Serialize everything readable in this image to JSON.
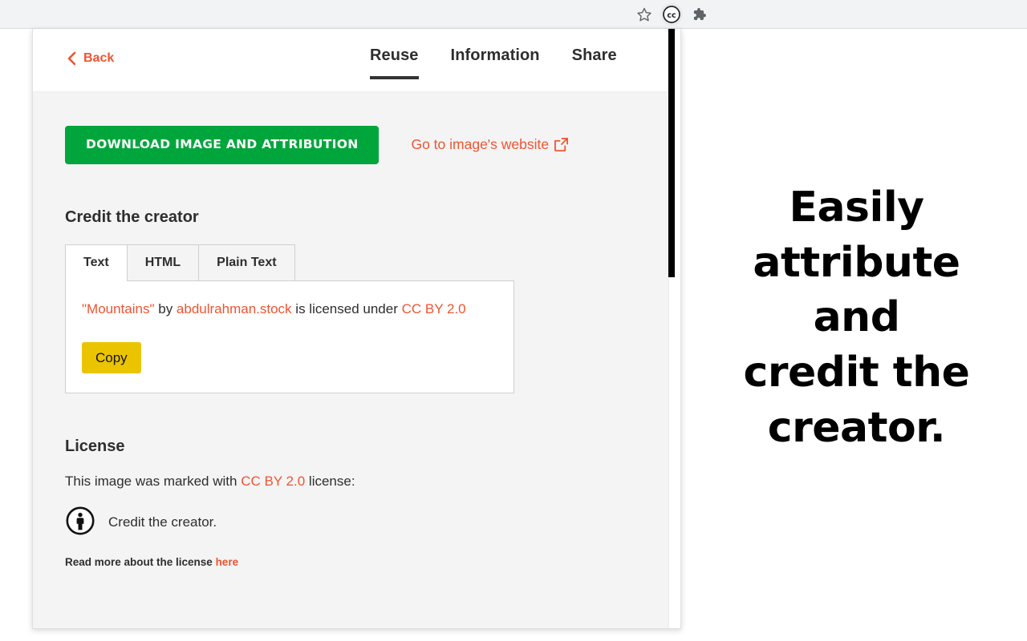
{
  "browser": {
    "toolbar_icons": [
      {
        "name": "bookmark-star-icon",
        "label": "Bookmark this tab"
      },
      {
        "name": "cc-extension-icon",
        "label": "CC"
      },
      {
        "name": "extensions-puzzle-icon",
        "label": "Extensions"
      }
    ]
  },
  "promo": {
    "lines": [
      "Easily attribute",
      "and",
      "credit the",
      "creator."
    ]
  },
  "popup": {
    "back_label": "Back",
    "tabs": [
      {
        "label": "Reuse",
        "active": true
      },
      {
        "label": "Information",
        "active": false
      },
      {
        "label": "Share",
        "active": false
      }
    ],
    "download_label": "DOWNLOAD IMAGE AND ATTRIBUTION",
    "website_link_label": "Go to image's website",
    "credit": {
      "heading": "Credit the creator",
      "format_tabs": [
        {
          "label": "Text",
          "active": true
        },
        {
          "label": "HTML",
          "active": false
        },
        {
          "label": "Plain Text",
          "active": false
        }
      ],
      "attribution": {
        "title": "\"Mountains\"",
        "by_word": " by ",
        "creator": "abdulrahman.stock",
        "middle": " is licensed under ",
        "license": "CC BY 2.0"
      },
      "copy_label": "Copy"
    },
    "license": {
      "heading": "License",
      "statement_prefix": "This image was marked with ",
      "statement_license": "CC BY 2.0",
      "statement_suffix": " license:",
      "terms": [
        {
          "icon": "cc-by-person-icon",
          "label": "Credit the creator."
        }
      ],
      "read_more_prefix": "Read more about the license ",
      "read_more_link": "here"
    }
  },
  "colors": {
    "accent_orange": "#ef5432",
    "download_green": "#00a63c",
    "copy_yellow": "#ebc400",
    "text_dark": "#2e2e2e",
    "panel_bg": "#f4f4f4"
  }
}
